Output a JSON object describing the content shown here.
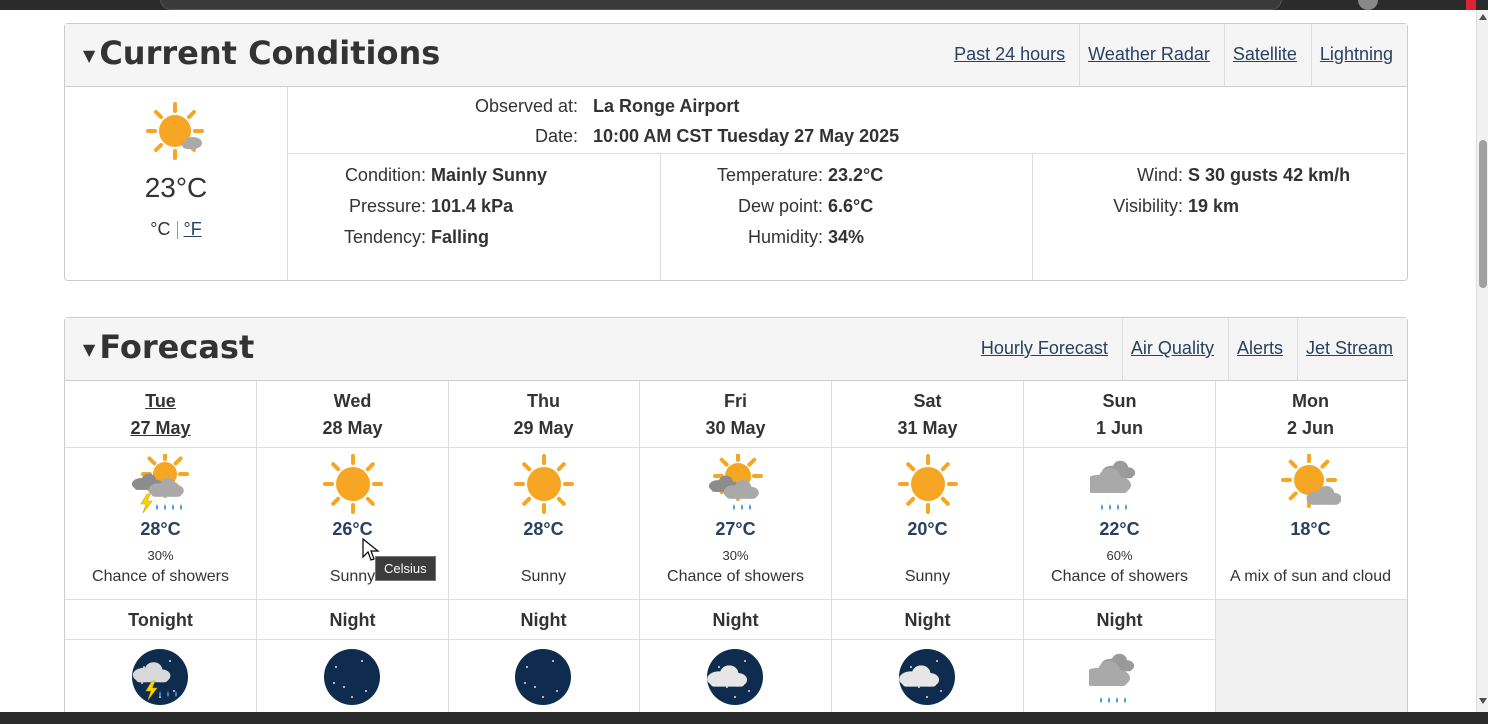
{
  "colors": {
    "accent": "#284162",
    "sun": "#f6a623",
    "cloud": "#a9a9a9",
    "rain": "#3b8fd9",
    "moon_bg": "#0f2c4f"
  },
  "current": {
    "title": "Current Conditions",
    "links": [
      "Past 24 hours",
      "Weather Radar",
      "Satellite",
      "Lightning"
    ],
    "icon": "sun-small-cloud-icon",
    "temperature": "23°C",
    "unit_c": "°C",
    "unit_f": "°F",
    "observed_label": "Observed at:",
    "observed_value": "La Ronge Airport",
    "date_label": "Date:",
    "date_value": "10:00 AM CST Tuesday 27 May 2025",
    "col1": [
      {
        "k": "Condition:",
        "v": "Mainly Sunny"
      },
      {
        "k": "Pressure:",
        "v": "101.4 kPa"
      },
      {
        "k": "Tendency:",
        "v": "Falling"
      }
    ],
    "col2": [
      {
        "k": "Temperature:",
        "v": "23.2°C"
      },
      {
        "k": "Dew point:",
        "v": "6.6°C"
      },
      {
        "k": "Humidity:",
        "v": "34%"
      }
    ],
    "col3": [
      {
        "k": "Wind:",
        "v": "S 30 gusts 42 km/h"
      },
      {
        "k": "Visibility:",
        "v": "19 km"
      }
    ]
  },
  "forecast": {
    "title": "Forecast",
    "links": [
      "Hourly Forecast",
      "Air Quality",
      "Alerts",
      "Jet Stream"
    ],
    "days": [
      {
        "day": "Tue",
        "date": "27 May",
        "temp": "28°C",
        "pop": "30%",
        "cond": "Chance of showers",
        "icon": "sun-cloud-lightning-rain-icon"
      },
      {
        "day": "Wed",
        "date": "28 May",
        "temp": "26°C",
        "pop": "",
        "cond": "Sunny",
        "icon": "sun-icon"
      },
      {
        "day": "Thu",
        "date": "29 May",
        "temp": "28°C",
        "pop": "",
        "cond": "Sunny",
        "icon": "sun-icon"
      },
      {
        "day": "Fri",
        "date": "30 May",
        "temp": "27°C",
        "pop": "30%",
        "cond": "Chance of showers",
        "icon": "sun-cloud-rain-icon"
      },
      {
        "day": "Sat",
        "date": "31 May",
        "temp": "20°C",
        "pop": "",
        "cond": "Sunny",
        "icon": "sun-icon"
      },
      {
        "day": "Sun",
        "date": "1 Jun",
        "temp": "22°C",
        "pop": "60%",
        "cond": "Chance of showers",
        "icon": "cloud-rain-icon"
      },
      {
        "day": "Mon",
        "date": "2 Jun",
        "temp": "18°C",
        "pop": "",
        "cond": "A mix of sun and cloud",
        "icon": "sun-cloud-icon"
      }
    ],
    "nights": [
      {
        "label": "Tonight",
        "icon": "moon-cloud-lightning-rain-icon"
      },
      {
        "label": "Night",
        "icon": "moon-icon"
      },
      {
        "label": "Night",
        "icon": "moon-icon"
      },
      {
        "label": "Night",
        "icon": "moon-cloud-icon"
      },
      {
        "label": "Night",
        "icon": "moon-cloud-icon"
      },
      {
        "label": "Night",
        "icon": "cloud-rain-icon"
      }
    ]
  },
  "tooltip": "Celsius"
}
